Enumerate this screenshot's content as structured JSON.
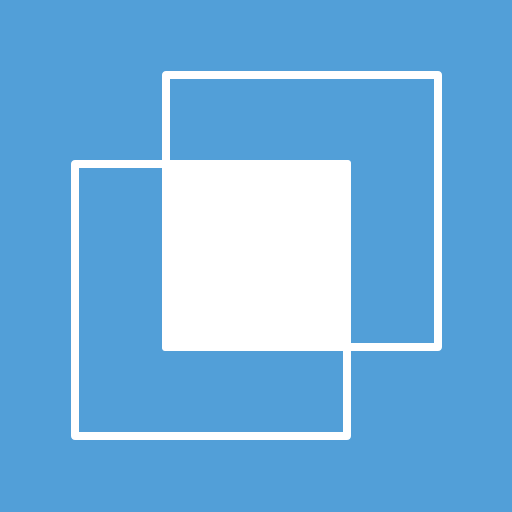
{
  "icon": {
    "name": "intersect-squares-icon",
    "background_color": "#529fd8",
    "foreground_color": "#ffffff"
  }
}
